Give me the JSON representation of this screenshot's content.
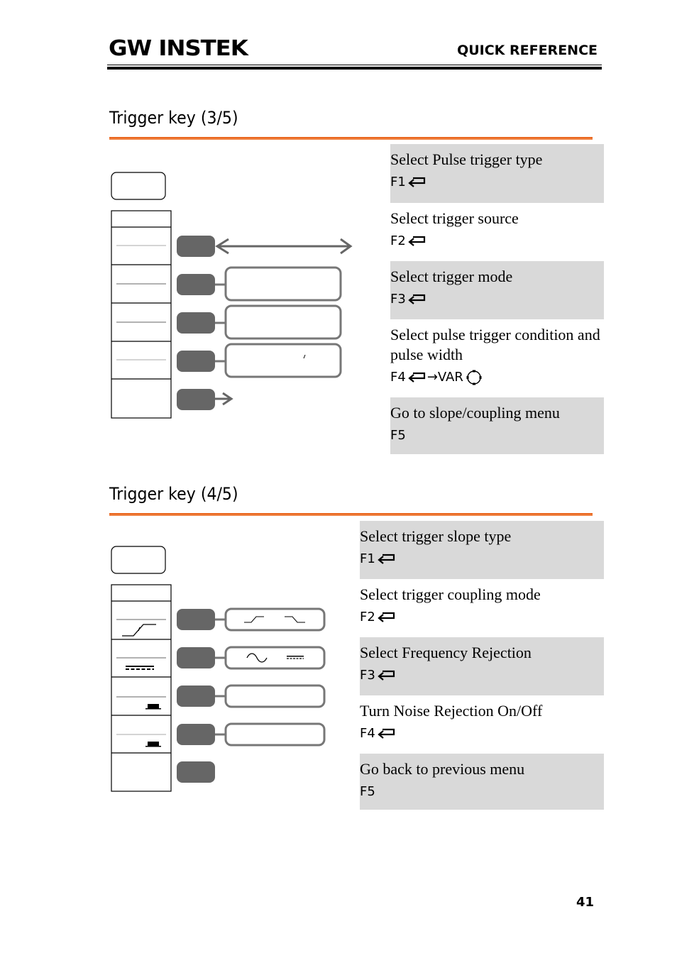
{
  "header": {
    "brand": "GW INSTEK",
    "section_label": "QUICK REFERENCE"
  },
  "sections": [
    {
      "title": "Trigger key (3/5)",
      "rows": [
        {
          "text": "Select Pulse trigger type",
          "key": "F1",
          "icon": "return-arrow-icon",
          "shaded": true
        },
        {
          "text": "Select trigger source",
          "key": "F2",
          "icon": "return-arrow-icon",
          "shaded": false
        },
        {
          "text": "Select trigger mode",
          "key": "F3",
          "icon": "return-arrow-icon",
          "shaded": true
        },
        {
          "text": "Select pulse trigger condition and pulse width",
          "key": "F4",
          "icon": "return-arrow-icon",
          "extra": "→VAR",
          "extra_icon": "var-knob-icon",
          "shaded": false
        },
        {
          "text": "Go to slope/coupling menu",
          "key": "F5",
          "icon": "",
          "shaded": true
        }
      ]
    },
    {
      "title": "Trigger key (4/5)",
      "rows": [
        {
          "text": "Select trigger slope type",
          "key": "F1",
          "icon": "return-arrow-icon",
          "shaded": true
        },
        {
          "text": "Select trigger coupling mode",
          "key": "F2",
          "icon": "return-arrow-icon",
          "shaded": false
        },
        {
          "text": "Select Frequency Rejection",
          "key": "F3",
          "icon": "return-arrow-icon",
          "shaded": true
        },
        {
          "text": "Turn Noise Rejection On/Off",
          "key": "F4",
          "icon": "return-arrow-icon",
          "shaded": false
        },
        {
          "text": "Go back to previous menu",
          "key": "F5",
          "icon": "",
          "shaded": true
        }
      ]
    }
  ],
  "page_number": "41",
  "colors": {
    "accent_orange": "#e85a0c",
    "row_shade": "#d9d9d9",
    "button_gray": "#666666"
  }
}
